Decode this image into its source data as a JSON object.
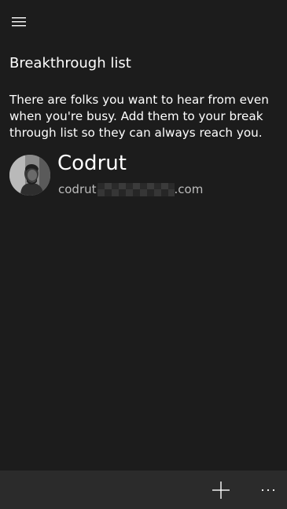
{
  "header": {
    "menu_icon": "hamburger-icon"
  },
  "main": {
    "title": "Breakthrough list",
    "description": "There are folks you want to hear from even when you're busy. Add them to your break through list so they can always reach you."
  },
  "contacts": [
    {
      "name": "Codrut",
      "email_prefix": "codrut",
      "email_suffix": ".com",
      "avatar_icon": "person-avatar"
    }
  ],
  "bottom_bar": {
    "add_icon": "plus-icon",
    "more_icon": "more-ellipsis-icon",
    "more_label": "···"
  }
}
